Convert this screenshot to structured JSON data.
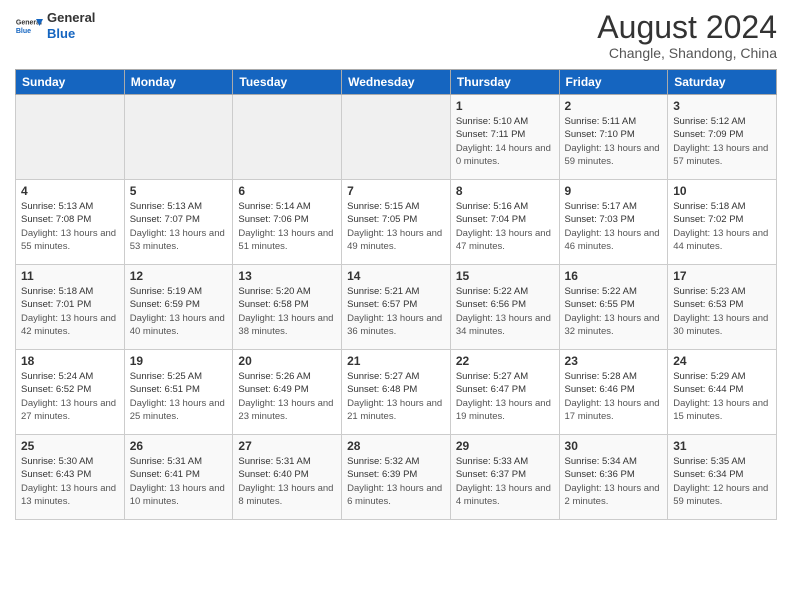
{
  "header": {
    "logo": {
      "general": "General",
      "blue": "Blue"
    },
    "title": "August 2024",
    "subtitle": "Changle, Shandong, China"
  },
  "weekdays": [
    "Sunday",
    "Monday",
    "Tuesday",
    "Wednesday",
    "Thursday",
    "Friday",
    "Saturday"
  ],
  "weeks": [
    [
      {
        "day": "",
        "empty": true
      },
      {
        "day": "",
        "empty": true
      },
      {
        "day": "",
        "empty": true
      },
      {
        "day": "",
        "empty": true
      },
      {
        "day": "1",
        "sunrise": "5:10 AM",
        "sunset": "7:11 PM",
        "daylight": "14 hours and 0 minutes."
      },
      {
        "day": "2",
        "sunrise": "5:11 AM",
        "sunset": "7:10 PM",
        "daylight": "13 hours and 59 minutes."
      },
      {
        "day": "3",
        "sunrise": "5:12 AM",
        "sunset": "7:09 PM",
        "daylight": "13 hours and 57 minutes."
      }
    ],
    [
      {
        "day": "4",
        "sunrise": "5:13 AM",
        "sunset": "7:08 PM",
        "daylight": "13 hours and 55 minutes."
      },
      {
        "day": "5",
        "sunrise": "5:13 AM",
        "sunset": "7:07 PM",
        "daylight": "13 hours and 53 minutes."
      },
      {
        "day": "6",
        "sunrise": "5:14 AM",
        "sunset": "7:06 PM",
        "daylight": "13 hours and 51 minutes."
      },
      {
        "day": "7",
        "sunrise": "5:15 AM",
        "sunset": "7:05 PM",
        "daylight": "13 hours and 49 minutes."
      },
      {
        "day": "8",
        "sunrise": "5:16 AM",
        "sunset": "7:04 PM",
        "daylight": "13 hours and 47 minutes."
      },
      {
        "day": "9",
        "sunrise": "5:17 AM",
        "sunset": "7:03 PM",
        "daylight": "13 hours and 46 minutes."
      },
      {
        "day": "10",
        "sunrise": "5:18 AM",
        "sunset": "7:02 PM",
        "daylight": "13 hours and 44 minutes."
      }
    ],
    [
      {
        "day": "11",
        "sunrise": "5:18 AM",
        "sunset": "7:01 PM",
        "daylight": "13 hours and 42 minutes."
      },
      {
        "day": "12",
        "sunrise": "5:19 AM",
        "sunset": "6:59 PM",
        "daylight": "13 hours and 40 minutes."
      },
      {
        "day": "13",
        "sunrise": "5:20 AM",
        "sunset": "6:58 PM",
        "daylight": "13 hours and 38 minutes."
      },
      {
        "day": "14",
        "sunrise": "5:21 AM",
        "sunset": "6:57 PM",
        "daylight": "13 hours and 36 minutes."
      },
      {
        "day": "15",
        "sunrise": "5:22 AM",
        "sunset": "6:56 PM",
        "daylight": "13 hours and 34 minutes."
      },
      {
        "day": "16",
        "sunrise": "5:22 AM",
        "sunset": "6:55 PM",
        "daylight": "13 hours and 32 minutes."
      },
      {
        "day": "17",
        "sunrise": "5:23 AM",
        "sunset": "6:53 PM",
        "daylight": "13 hours and 30 minutes."
      }
    ],
    [
      {
        "day": "18",
        "sunrise": "5:24 AM",
        "sunset": "6:52 PM",
        "daylight": "13 hours and 27 minutes."
      },
      {
        "day": "19",
        "sunrise": "5:25 AM",
        "sunset": "6:51 PM",
        "daylight": "13 hours and 25 minutes."
      },
      {
        "day": "20",
        "sunrise": "5:26 AM",
        "sunset": "6:49 PM",
        "daylight": "13 hours and 23 minutes."
      },
      {
        "day": "21",
        "sunrise": "5:27 AM",
        "sunset": "6:48 PM",
        "daylight": "13 hours and 21 minutes."
      },
      {
        "day": "22",
        "sunrise": "5:27 AM",
        "sunset": "6:47 PM",
        "daylight": "13 hours and 19 minutes."
      },
      {
        "day": "23",
        "sunrise": "5:28 AM",
        "sunset": "6:46 PM",
        "daylight": "13 hours and 17 minutes."
      },
      {
        "day": "24",
        "sunrise": "5:29 AM",
        "sunset": "6:44 PM",
        "daylight": "13 hours and 15 minutes."
      }
    ],
    [
      {
        "day": "25",
        "sunrise": "5:30 AM",
        "sunset": "6:43 PM",
        "daylight": "13 hours and 13 minutes."
      },
      {
        "day": "26",
        "sunrise": "5:31 AM",
        "sunset": "6:41 PM",
        "daylight": "13 hours and 10 minutes."
      },
      {
        "day": "27",
        "sunrise": "5:31 AM",
        "sunset": "6:40 PM",
        "daylight": "13 hours and 8 minutes."
      },
      {
        "day": "28",
        "sunrise": "5:32 AM",
        "sunset": "6:39 PM",
        "daylight": "13 hours and 6 minutes."
      },
      {
        "day": "29",
        "sunrise": "5:33 AM",
        "sunset": "6:37 PM",
        "daylight": "13 hours and 4 minutes."
      },
      {
        "day": "30",
        "sunrise": "5:34 AM",
        "sunset": "6:36 PM",
        "daylight": "13 hours and 2 minutes."
      },
      {
        "day": "31",
        "sunrise": "5:35 AM",
        "sunset": "6:34 PM",
        "daylight": "12 hours and 59 minutes."
      }
    ]
  ]
}
